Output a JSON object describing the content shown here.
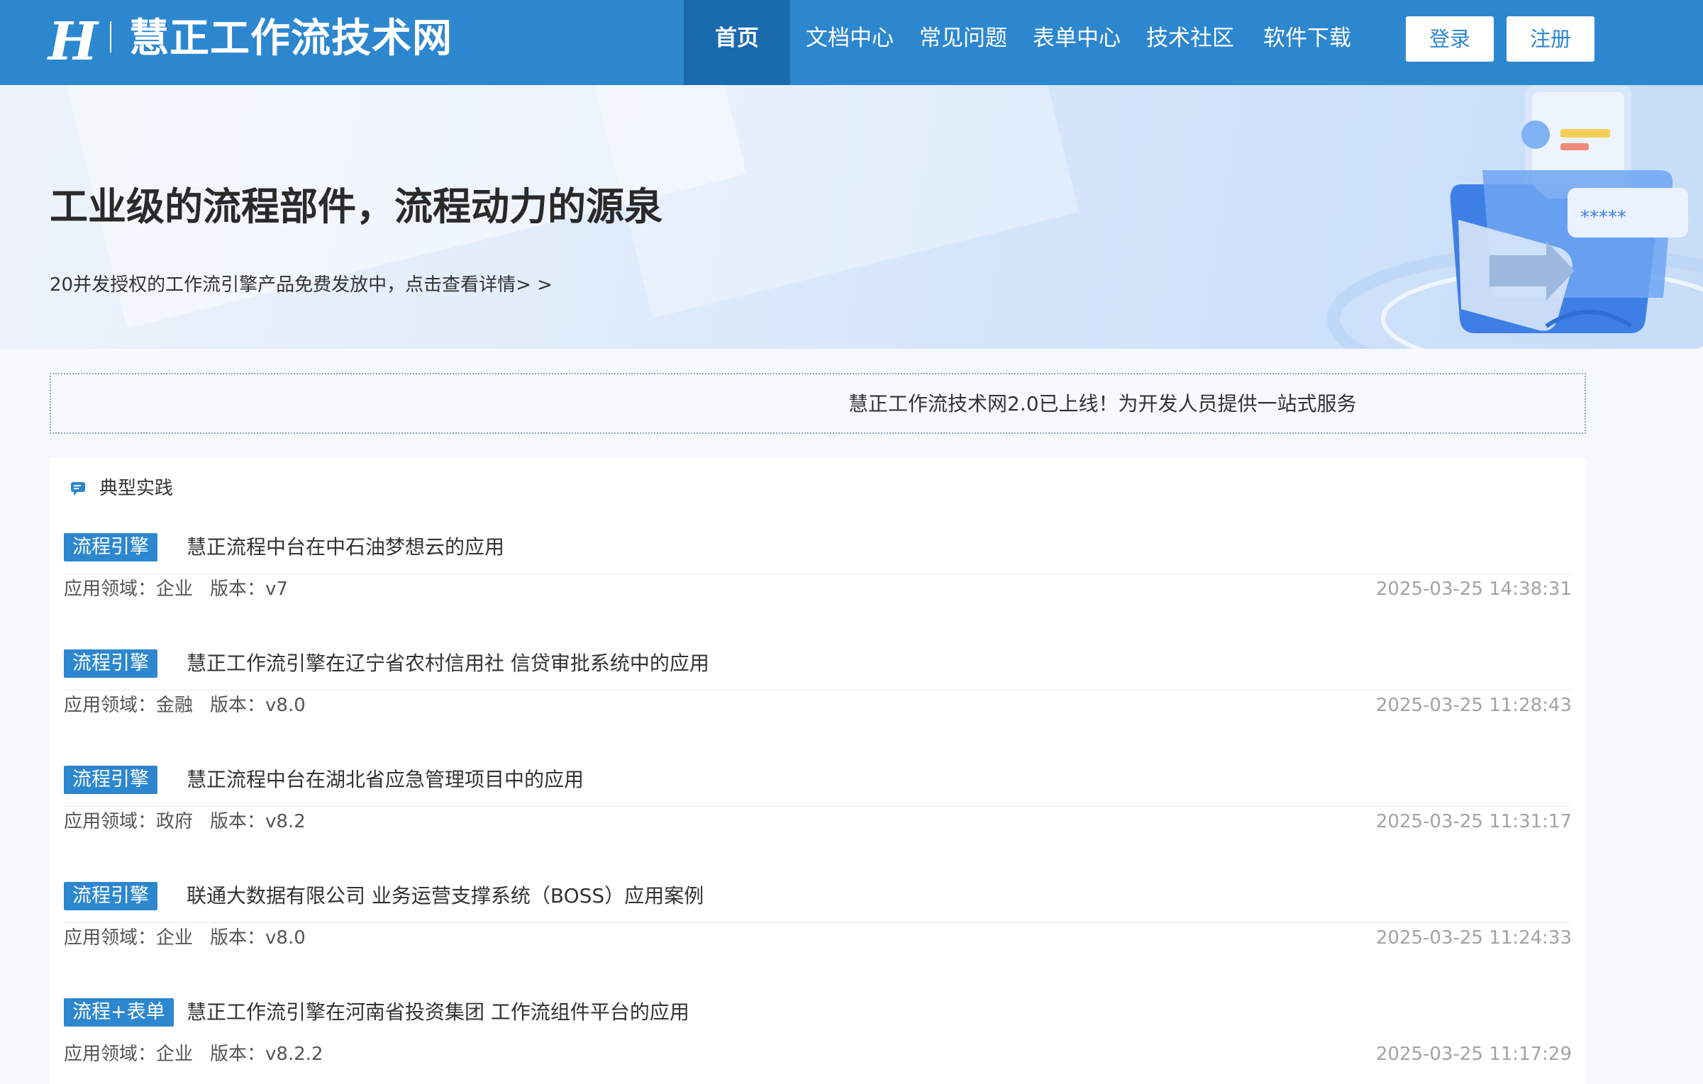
{
  "header": {
    "logo_letter": "H",
    "site_title": "慧正工作流技术网",
    "nav": [
      {
        "label": "首页",
        "active": true
      },
      {
        "label": "文档中心",
        "active": false
      },
      {
        "label": "常见问题",
        "active": false
      },
      {
        "label": "表单中心",
        "active": false
      },
      {
        "label": "技术社区",
        "active": false
      },
      {
        "label": "软件下载",
        "active": false
      }
    ],
    "login_label": "登录",
    "register_label": "注册"
  },
  "banner": {
    "title": "工业级的流程部件，流程动力的源泉",
    "subtitle": "20并发授权的工作流引擎产品免费发放中，点击查看详情> >"
  },
  "notice": {
    "text": "慧正工作流技术网2.0已上线！为开发人员提供一站式服务"
  },
  "practices": {
    "section_icon": "chat-icon",
    "section_title": "典型实践",
    "field_label": "应用领域：",
    "version_label": "版本：",
    "items": [
      {
        "tag": "流程引擎",
        "title": "慧正流程中台在中石油梦想云的应用",
        "field": "企业",
        "version": "v7",
        "date": "2025-03-25 14:38:31"
      },
      {
        "tag": "流程引擎",
        "title": "慧正工作流引擎在辽宁省农村信用社 信贷审批系统中的应用",
        "field": "金融",
        "version": "v8.0",
        "date": "2025-03-25 11:28:43"
      },
      {
        "tag": "流程引擎",
        "title": "慧正流程中台在湖北省应急管理项目中的应用",
        "field": "政府",
        "version": "v8.2",
        "date": "2025-03-25 11:31:17"
      },
      {
        "tag": "流程引擎",
        "title": "联通大数据有限公司 业务运营支撑系统（BOSS）应用案例",
        "field": "企业",
        "version": "v8.0",
        "date": "2025-03-25 11:24:33"
      },
      {
        "tag": "流程+表单",
        "title": "慧正工作流引擎在河南省投资集团 工作流组件平台的应用",
        "field": "企业",
        "version": "v8.2.2",
        "date": "2025-03-25 11:17:29"
      }
    ]
  },
  "colors": {
    "primary": "#2d87cf",
    "nav_active": "#1a6aae",
    "date_text": "#a3a3a3"
  }
}
